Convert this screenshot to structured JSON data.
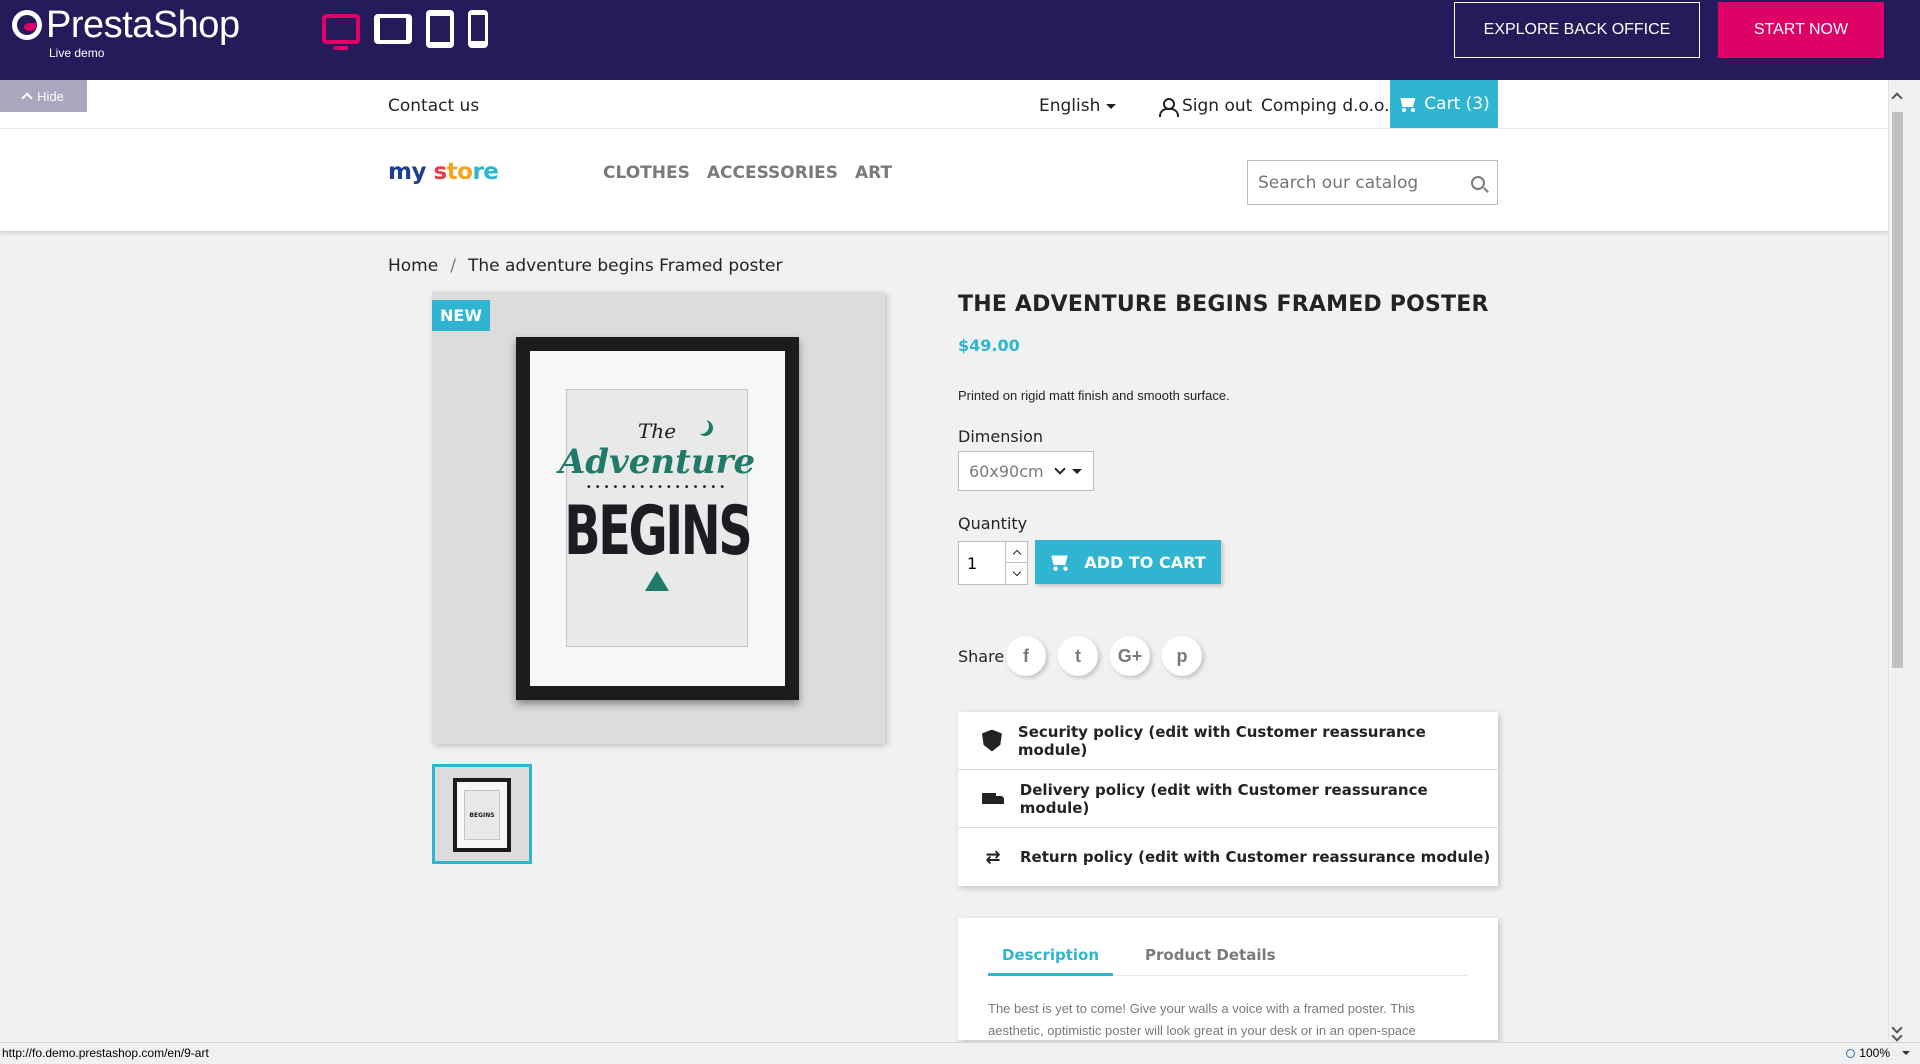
{
  "demo_bar": {
    "logo_name": "PrestaShop",
    "logo_sub": "Live demo",
    "devices": [
      "desktop-icon",
      "tablet-landscape-icon",
      "tablet-portrait-icon",
      "phone-icon"
    ],
    "explore_label": "EXPLORE BACK OFFICE",
    "start_label": "START NOW",
    "accent_color": "#df0067",
    "bg_color": "#251b5b"
  },
  "hide_tab": {
    "label": "Hide"
  },
  "nav_top": {
    "contact": "Contact us",
    "language": "English",
    "signout": "Sign out",
    "company": "Comping d.o.o.",
    "cart": "Cart (3)"
  },
  "header": {
    "logo_parts": [
      "my",
      " s",
      "to",
      "re"
    ],
    "menu": [
      "CLOTHES",
      "ACCESSORIES",
      "ART"
    ],
    "search_placeholder": "Search our catalog"
  },
  "breadcrumb": {
    "home": "Home",
    "separator": "/",
    "current": "The adventure begins Framed poster"
  },
  "product": {
    "badge": "NEW",
    "poster_text": {
      "the": "The",
      "adventure": "Adventure",
      "begins": "BEGINS"
    },
    "title": "THE ADVENTURE BEGINS FRAMED POSTER",
    "price": "$49.00",
    "short_description": "Printed on rigid matt finish and smooth surface.",
    "dimension_label": "Dimension",
    "dimension_value": "60x90cm",
    "quantity_label": "Quantity",
    "quantity_value": "1",
    "add_to_cart": "ADD TO CART",
    "share_label": "Share",
    "share_icons": [
      "facebook-icon",
      "twitter-icon",
      "google-plus-icon",
      "pinterest-icon"
    ],
    "reassurance": [
      {
        "icon": "shield-icon",
        "label": "Security policy (edit with Customer reassurance module)"
      },
      {
        "icon": "truck-icon",
        "label": "Delivery policy (edit with Customer reassurance module)"
      },
      {
        "icon": "swap-arrows-icon",
        "label": "Return policy (edit with Customer reassurance module)"
      }
    ],
    "tabs": [
      "Description",
      "Product Details"
    ],
    "description": "The best is yet to come! Give your walls a voice with a framed poster. This aesthetic, optimistic poster will look great in your desk or in an open-space"
  },
  "colors": {
    "brand_blue": "#2fb5d2"
  },
  "statusbar": {
    "url": "http://fo.demo.prestashop.com/en/9-art",
    "zoom": "100%"
  }
}
